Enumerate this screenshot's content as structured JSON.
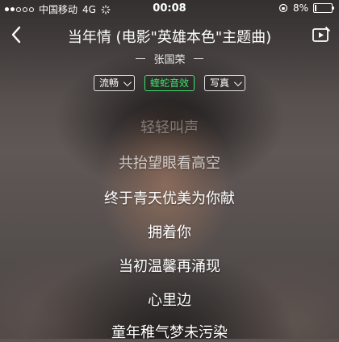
{
  "status_bar": {
    "carrier": "中国移动",
    "network": "4G",
    "time": "00:08",
    "battery": "8%"
  },
  "header": {
    "title": "当年情 (电影\"英雄本色\"主题曲)",
    "artist": "张国荣"
  },
  "controls": {
    "quality": "流畅",
    "effect": "蝰蛇音效",
    "photo": "写真"
  },
  "lyrics": [
    "轻轻叫声",
    "共抬望眼看高空",
    "终于青天优美为你献",
    "拥着你",
    "当初温馨再涌现",
    "心里边",
    "童年稚气梦未污染"
  ],
  "colors": {
    "accent_green": "#3ee26b",
    "text": "#ffffff"
  }
}
